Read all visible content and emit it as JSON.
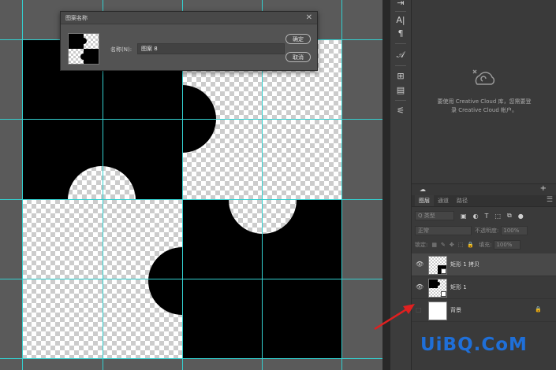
{
  "dialog": {
    "title": "图案名称",
    "close_glyph": "✕",
    "name_label": "名称(N):",
    "name_value": "图案 8",
    "ok_label": "确定",
    "cancel_label": "取消"
  },
  "tools": [
    {
      "name": "paragraph-align-icon",
      "glyph": "⇥"
    },
    {
      "name": "character-icon",
      "glyph": "A|"
    },
    {
      "name": "paragraph-icon",
      "glyph": "¶"
    },
    {
      "name": "glyph-icon",
      "glyph": "𝒜"
    },
    {
      "name": "library-icon",
      "glyph": "⊞"
    },
    {
      "name": "notes-icon",
      "glyph": "▤"
    },
    {
      "name": "adjustments-icon",
      "glyph": "⚟"
    }
  ],
  "cc_panel": {
    "line1": "要使用 Creative Cloud 库，您需要登",
    "line2": "录 Creative Cloud 帐户。",
    "footer_plus": "+"
  },
  "layers_panel": {
    "tabs": [
      "图层",
      "通道",
      "路径"
    ],
    "active_tab": 0,
    "filter_label": "Q 类型",
    "blend_mode": "正常",
    "opacity_label": "不透明度:",
    "opacity_value": "100%",
    "lock_label": "锁定:",
    "fill_label": "填充:",
    "fill_value": "100%",
    "layers": [
      {
        "name": "矩形 1 拷贝",
        "visible": true,
        "selected": true
      },
      {
        "name": "矩形 1",
        "visible": true,
        "selected": false
      },
      {
        "name": "背景",
        "visible": false,
        "selected": false,
        "locked": true
      }
    ]
  },
  "watermark": "UiBQ.CoM",
  "colors": {
    "guide": "#34d0d0",
    "arrow": "#e02020",
    "watermark": "#1f6fd8"
  }
}
